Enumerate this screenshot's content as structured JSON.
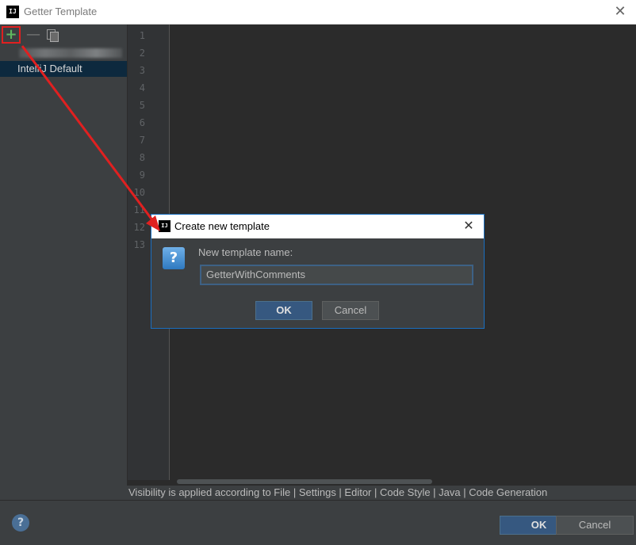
{
  "window": {
    "title": "Getter Template",
    "app_icon": "IJ",
    "close_glyph": "✕"
  },
  "left_panel": {
    "toolbar": {
      "add_glyph": "+",
      "remove_glyph": "—"
    },
    "items": [
      {
        "label": "IntelliJ Default",
        "selected": true
      }
    ]
  },
  "editor": {
    "line_numbers": [
      "1",
      "2",
      "3",
      "4",
      "5",
      "6",
      "7",
      "8",
      "9",
      "10",
      "11",
      "12",
      "13"
    ]
  },
  "info_text": "Visibility is applied according to File | Settings | Editor | Code Style | Java | Code Generation",
  "footer": {
    "help_glyph": "?",
    "ok_label": "OK",
    "cancel_label": "Cancel"
  },
  "dialog": {
    "title": "Create new template",
    "app_icon": "IJ",
    "close_glyph": "✕",
    "question_glyph": "?",
    "prompt_label": "New template name:",
    "input_value": "GetterWithComments",
    "ok_label": "OK",
    "cancel_label": "Cancel"
  },
  "colors": {
    "accent": "#365880",
    "annotation_arrow": "#e02020",
    "keyword": "#cc7832",
    "variable": "#e8bf6a"
  }
}
